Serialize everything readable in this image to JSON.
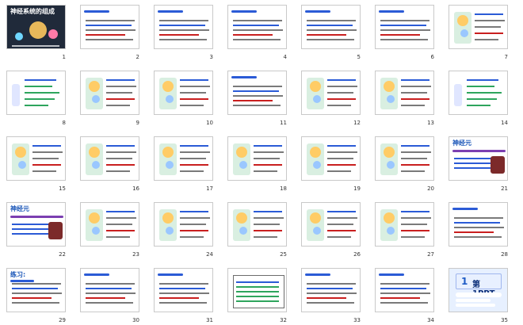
{
  "slide_sorter": {
    "slides": [
      {
        "number": "1",
        "title": "神经系统的组成",
        "theme": "dark-neurons"
      },
      {
        "number": "2",
        "title": "",
        "theme": "white-text"
      },
      {
        "number": "3",
        "title": "",
        "theme": "white-text"
      },
      {
        "number": "4",
        "title": "",
        "theme": "white-text"
      },
      {
        "number": "5",
        "title": "",
        "theme": "white-text"
      },
      {
        "number": "6",
        "title": "",
        "theme": "white-text"
      },
      {
        "number": "7",
        "title": "",
        "theme": "white-diagram"
      },
      {
        "number": "8",
        "title": "",
        "theme": "white-tree"
      },
      {
        "number": "9",
        "title": "",
        "theme": "white-diagram"
      },
      {
        "number": "10",
        "title": "",
        "theme": "white-diagram"
      },
      {
        "number": "11",
        "title": "",
        "theme": "white-text"
      },
      {
        "number": "12",
        "title": "",
        "theme": "white-diagram"
      },
      {
        "number": "13",
        "title": "",
        "theme": "white-diagram"
      },
      {
        "number": "14",
        "title": "",
        "theme": "white-tree"
      },
      {
        "number": "15",
        "title": "",
        "theme": "white-diagram"
      },
      {
        "number": "16",
        "title": "",
        "theme": "white-diagram"
      },
      {
        "number": "17",
        "title": "",
        "theme": "white-diagram"
      },
      {
        "number": "18",
        "title": "",
        "theme": "white-diagram"
      },
      {
        "number": "19",
        "title": "",
        "theme": "white-diagram"
      },
      {
        "number": "20",
        "title": "",
        "theme": "white-diagram"
      },
      {
        "number": "21",
        "title": "神经元",
        "theme": "white-title"
      },
      {
        "number": "22",
        "title": "神经元",
        "theme": "white-title"
      },
      {
        "number": "23",
        "title": "",
        "theme": "white-diagram"
      },
      {
        "number": "24",
        "title": "",
        "theme": "white-diagram"
      },
      {
        "number": "25",
        "title": "",
        "theme": "white-diagram"
      },
      {
        "number": "26",
        "title": "",
        "theme": "white-diagram"
      },
      {
        "number": "27",
        "title": "",
        "theme": "white-diagram"
      },
      {
        "number": "28",
        "title": "",
        "theme": "white-text"
      },
      {
        "number": "29",
        "title": "练习:",
        "theme": "white-text"
      },
      {
        "number": "30",
        "title": "",
        "theme": "white-text"
      },
      {
        "number": "31",
        "title": "",
        "theme": "white-text"
      },
      {
        "number": "32",
        "title": "",
        "theme": "white-table"
      },
      {
        "number": "33",
        "title": "",
        "theme": "white-text"
      },
      {
        "number": "34",
        "title": "",
        "theme": "white-text"
      },
      {
        "number": "35",
        "title": "第1PPT",
        "theme": "logo"
      }
    ]
  }
}
